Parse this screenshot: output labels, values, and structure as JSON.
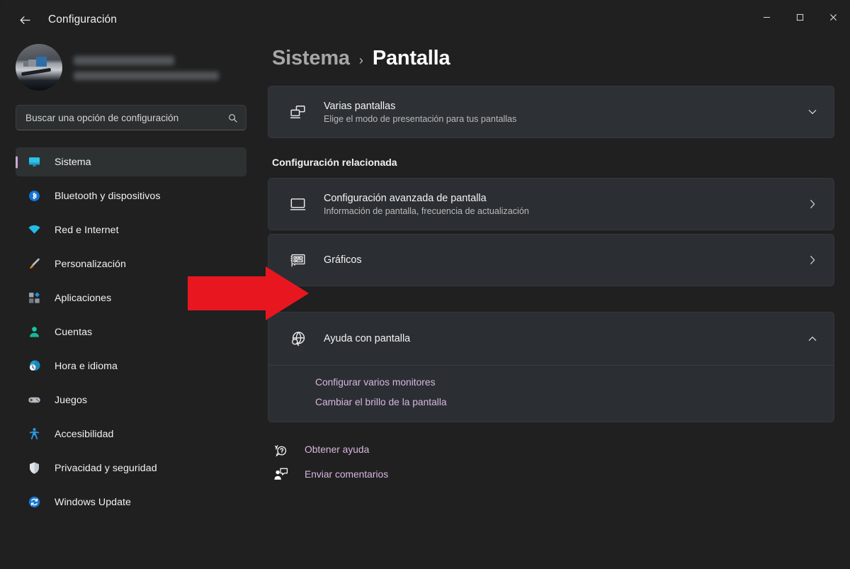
{
  "window": {
    "app_title": "Configuración",
    "back_icon": "arrow-left-icon",
    "controls": {
      "minimize": "minimize-icon",
      "maximize": "maximize-icon",
      "close": "close-icon"
    }
  },
  "sidebar": {
    "profile": {
      "avatar_icon": "user-avatar-photo",
      "name_redacted": true,
      "email_redacted": true
    },
    "search": {
      "placeholder": "Buscar una opción de configuración",
      "value": "",
      "icon": "search-icon"
    },
    "items": [
      {
        "label": "Sistema",
        "icon": "monitor-icon",
        "active": true
      },
      {
        "label": "Bluetooth y dispositivos",
        "icon": "bluetooth-icon",
        "active": false
      },
      {
        "label": "Red e Internet",
        "icon": "wifi-icon",
        "active": false
      },
      {
        "label": "Personalización",
        "icon": "paintbrush-icon",
        "active": false
      },
      {
        "label": "Aplicaciones",
        "icon": "apps-icon",
        "active": false
      },
      {
        "label": "Cuentas",
        "icon": "account-icon",
        "active": false
      },
      {
        "label": "Hora e idioma",
        "icon": "clock-globe-icon",
        "active": false
      },
      {
        "label": "Juegos",
        "icon": "gamepad-icon",
        "active": false
      },
      {
        "label": "Accesibilidad",
        "icon": "accessibility-icon",
        "active": false
      },
      {
        "label": "Privacidad y seguridad",
        "icon": "shield-icon",
        "active": false
      },
      {
        "label": "Windows Update",
        "icon": "update-refresh-icon",
        "active": false
      }
    ]
  },
  "main": {
    "breadcrumb": {
      "parent": "Sistema",
      "separator": "›",
      "current": "Pantalla"
    },
    "multi_display_card": {
      "title": "Varias pantallas",
      "subtitle": "Elige el modo de presentación para tus pantallas",
      "icon": "multiple-monitors-icon",
      "chevron": "chevron-down-icon"
    },
    "related_section_title": "Configuración relacionada",
    "related_items": [
      {
        "title": "Configuración avanzada de pantalla",
        "subtitle": "Información de pantalla, frecuencia de actualización",
        "icon": "display-icon",
        "chevron": "chevron-right-icon"
      },
      {
        "title": "Gráficos",
        "subtitle": "",
        "icon": "graphics-card-icon",
        "chevron": "chevron-right-icon"
      }
    ],
    "help_group": {
      "title": "Ayuda con pantalla",
      "icon": "globe-search-icon",
      "chevron": "chevron-up-icon",
      "links": [
        "Configurar varios monitores",
        "Cambiar el brillo de la pantalla"
      ]
    },
    "footer_links": [
      {
        "label": "Obtener ayuda",
        "icon": "help-question-icon"
      },
      {
        "label": "Enviar comentarios",
        "icon": "feedback-icon"
      }
    ]
  },
  "annotation": {
    "arrow_color": "#e8171f",
    "points_to": "Gráficos"
  },
  "colors": {
    "page_background": "#202020",
    "card_background": "#2b2f33",
    "accent_bar": "#cfa8d8",
    "link": "#d7b6e0",
    "arrow_red": "#e8171f"
  }
}
